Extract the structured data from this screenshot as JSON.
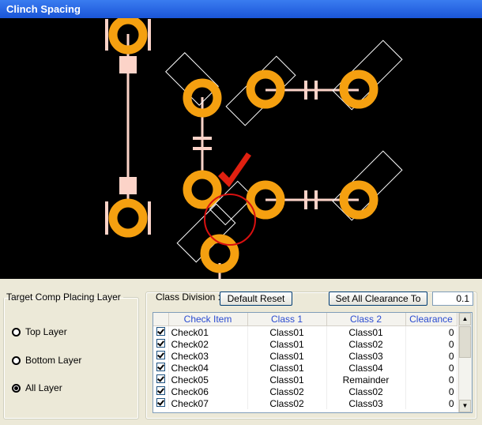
{
  "window": {
    "title": "Clinch Spacing"
  },
  "layer_group": {
    "legend": "Target Comp Placing Layer",
    "options": [
      {
        "label": "Top Layer",
        "selected": false
      },
      {
        "label": "Bottom Layer",
        "selected": false
      },
      {
        "label": "All Layer",
        "selected": true
      }
    ]
  },
  "class_division": {
    "label": "Class Division :",
    "default_reset_label": "Default Reset",
    "set_all_label": "Set All Clearance To",
    "clearance_value": "0.1"
  },
  "table": {
    "headers": [
      "Check Item",
      "Class 1",
      "Class 2",
      "Clearance"
    ],
    "rows": [
      {
        "checked": true,
        "item": "Check01",
        "class1": "Class01",
        "class2": "Class01",
        "clearance": "0"
      },
      {
        "checked": true,
        "item": "Check02",
        "class1": "Class01",
        "class2": "Class02",
        "clearance": "0"
      },
      {
        "checked": true,
        "item": "Check03",
        "class1": "Class01",
        "class2": "Class03",
        "clearance": "0"
      },
      {
        "checked": true,
        "item": "Check04",
        "class1": "Class01",
        "class2": "Class04",
        "clearance": "0"
      },
      {
        "checked": true,
        "item": "Check05",
        "class1": "Class01",
        "class2": "Remainder",
        "clearance": "0"
      },
      {
        "checked": true,
        "item": "Check06",
        "class1": "Class02",
        "class2": "Class02",
        "clearance": "0"
      },
      {
        "checked": true,
        "item": "Check07",
        "class1": "Class02",
        "class2": "Class03",
        "clearance": "0"
      }
    ]
  },
  "colors": {
    "pad": "#f5a010",
    "trace": "#fcd3c8",
    "check": "#e02010",
    "circle": "#d81010"
  }
}
